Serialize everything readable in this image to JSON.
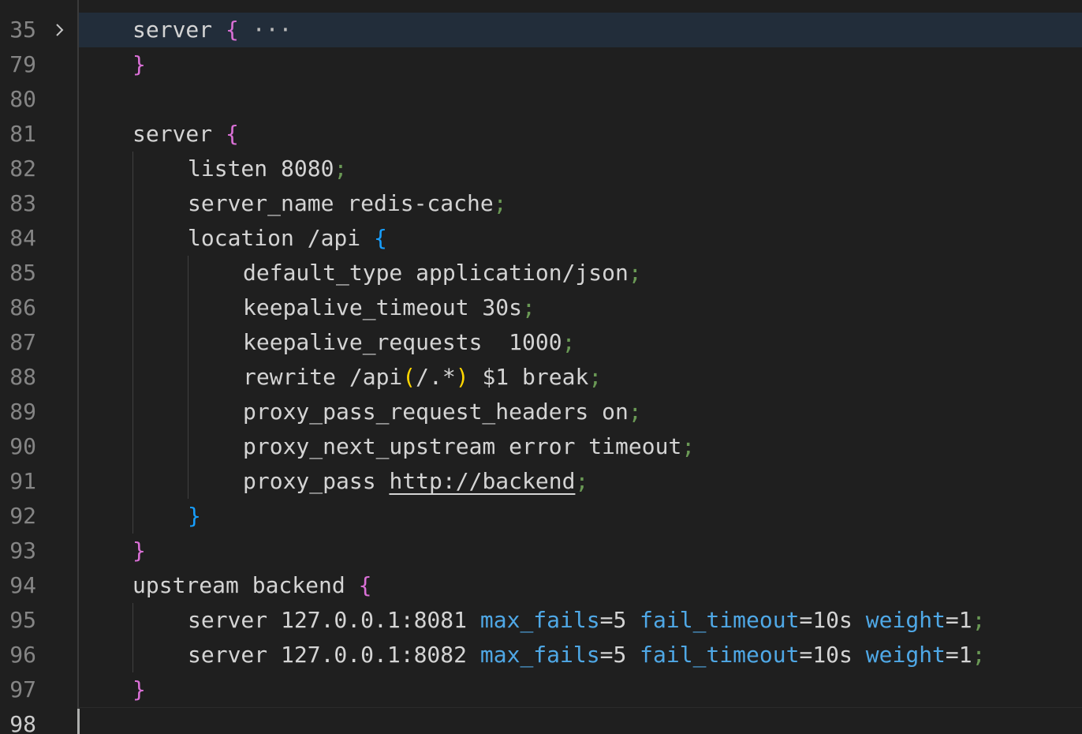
{
  "editor": {
    "theme_colors": {
      "background": "#1f1f1f",
      "line_number": "#858585",
      "text": "#d4d4d4",
      "bracket_level1": "#da70d6",
      "bracket_level2": "#179fff",
      "bracket_level3": "#ffd700",
      "punctuation": "#6a9955",
      "parameter": "#4fa8e6",
      "folded_highlight": "#222d3a"
    },
    "fold_icon": "chevron-right-icon",
    "lines": [
      {
        "n": "35",
        "t1": "server ",
        "b1": "{",
        "ellipsis": "···"
      },
      {
        "n": "79",
        "b1": "}"
      },
      {
        "n": "80"
      },
      {
        "n": "81",
        "t1": "server ",
        "b1": "{"
      },
      {
        "n": "82",
        "t1": "listen 8080",
        "s": ";"
      },
      {
        "n": "83",
        "t1": "server_name redis-cache",
        "s": ";"
      },
      {
        "n": "84",
        "t1": "location /api ",
        "b1": "{"
      },
      {
        "n": "85",
        "t1": "default_type application/json",
        "s": ";"
      },
      {
        "n": "86",
        "t1": "keepalive_timeout 30s",
        "s": ";"
      },
      {
        "n": "87",
        "t1": "keepalive_requests  1000",
        "s": ";"
      },
      {
        "n": "88",
        "t1": "rewrite /api",
        "b1": "(",
        "t2": "/.*",
        "b2": ")",
        "t3": " $1 break",
        "s": ";"
      },
      {
        "n": "89",
        "t1": "proxy_pass_request_headers on",
        "s": ";"
      },
      {
        "n": "90",
        "t1": "proxy_next_upstream error timeout",
        "s": ";"
      },
      {
        "n": "91",
        "t1": "proxy_pass ",
        "u": "http://backend",
        "s": ";"
      },
      {
        "n": "92",
        "b1": "}"
      },
      {
        "n": "93",
        "b1": "}"
      },
      {
        "n": "94",
        "t1": "upstream backend ",
        "b1": "{"
      },
      {
        "n": "95",
        "t1": "server 127.0.0.1:8081 ",
        "p1": "max_fails",
        "e1": "=5 ",
        "p2": "fail_timeout",
        "e2": "=10s ",
        "p3": "weight",
        "e3": "=1",
        "s": ";"
      },
      {
        "n": "96",
        "t1": "server 127.0.0.1:8082 ",
        "p1": "max_fails",
        "e1": "=5 ",
        "p2": "fail_timeout",
        "e2": "=10s ",
        "p3": "weight",
        "e3": "=1",
        "s": ";"
      },
      {
        "n": "97",
        "b1": "}"
      },
      {
        "n": "98"
      }
    ]
  }
}
